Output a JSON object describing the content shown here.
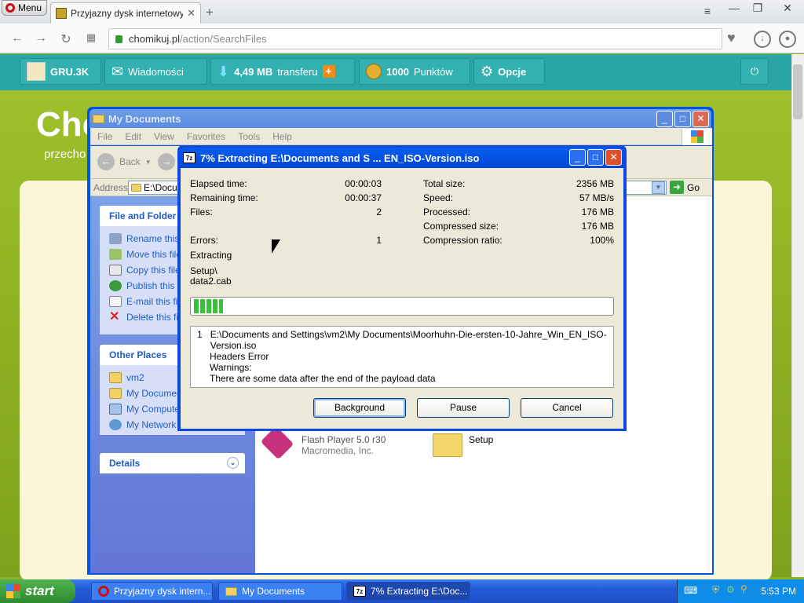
{
  "browser": {
    "menu_label": "Menu",
    "tab_title": "Przyjazny dysk internetowy - ",
    "url_host": "chomikuj.pl",
    "url_path": "/action/SearchFiles"
  },
  "site_bar": {
    "user": "GRU.3K",
    "messages": "Wiadomości",
    "transfer_amount": "4,49 MB",
    "transfer_label": "transferu",
    "plus": "+",
    "points_amount": "1000",
    "points_label": "Punktów",
    "options": "Opcje"
  },
  "site": {
    "logo": "Cho",
    "subtitle": "przecho"
  },
  "explorer": {
    "title": "My Documents",
    "menu": [
      "File",
      "Edit",
      "View",
      "Favorites",
      "Tools",
      "Help"
    ],
    "back_label": "Back",
    "address_label": "Address",
    "address_value": "E:\\Docur",
    "go_label": "Go",
    "file_folder_tasks": {
      "header": "File and Folder T",
      "items": [
        "Rename this f",
        "Move this file",
        "Copy this file",
        "Publish this f",
        "E-mail this fil",
        "Delete this fil"
      ]
    },
    "other_places": {
      "header": "Other Places",
      "items": [
        "vm2",
        "My Document",
        "My Computer",
        "My Network P"
      ]
    },
    "details": {
      "header": "Details"
    },
    "files": [
      {
        "name": "Flash Player 5.0 r30",
        "company": "Macromedia, Inc."
      },
      {
        "name": "Setup"
      }
    ]
  },
  "dialog": {
    "title": "7% Extracting E:\\Documents and S ... EN_ISO-Version.iso",
    "icon_text": "7z",
    "left_stats": [
      {
        "label": "Elapsed time:",
        "value": "00:00:03"
      },
      {
        "label": "Remaining time:",
        "value": "00:00:37"
      },
      {
        "label": "Files:",
        "value": "2"
      },
      {
        "label": "",
        "value": ""
      },
      {
        "label": "Errors:",
        "value": "1"
      }
    ],
    "right_stats": [
      {
        "label": "Total size:",
        "value": "2356 MB"
      },
      {
        "label": "Speed:",
        "value": "57 MB/s"
      },
      {
        "label": "Processed:",
        "value": "176 MB"
      },
      {
        "label": "Compressed size:",
        "value": "176 MB"
      },
      {
        "label": "Compression ratio:",
        "value": "100%"
      }
    ],
    "status": "Extracting",
    "current_path": "Setup\\",
    "current_file": "data2.cab",
    "progress_fraction": 0.07,
    "messages": {
      "index": "1",
      "path": "E:\\Documents and Settings\\vm2\\My Documents\\Moorhuhn-Die-ersten-10-Jahre_Win_EN_ISO-Version.iso",
      "line2": "Headers Error",
      "line3": "Warnings:",
      "line4": "There are some data after the end of the payload data"
    },
    "buttons": {
      "background": "Background",
      "pause": "Pause",
      "cancel": "Cancel"
    }
  },
  "taskbar": {
    "start": "start",
    "tasks": [
      "Przyjazny dysk intern...",
      "My Documents",
      "7% Extracting E:\\Doc..."
    ],
    "time": "5:53 PM"
  }
}
